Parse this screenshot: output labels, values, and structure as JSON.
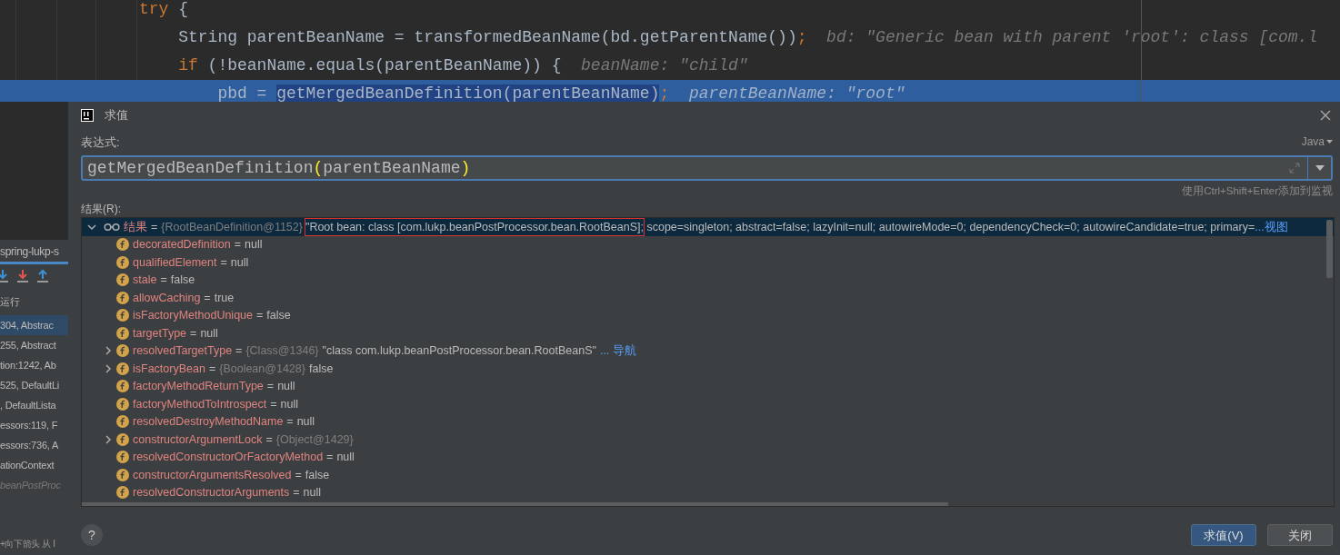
{
  "editor": {
    "lines": [
      {
        "highlighted": false,
        "tokens": [
          {
            "text": "try",
            "kind": "keyword"
          },
          {
            "text": " {",
            "kind": "plain"
          }
        ],
        "children": [
          {
            "highlighted": false,
            "tokens": [
              {
                "text": "String parentBeanName = transformedBeanName(bd.getParentName())",
                "kind": "plain"
              },
              {
                "text": ";",
                "kind": "semicolon"
              }
            ],
            "hint": "bd: \"Generic bean with parent 'root': class [com.l"
          },
          {
            "highlighted": false,
            "tokens": [
              {
                "text": "if",
                "kind": "keyword"
              },
              {
                "text": " (!beanName.equals(parentBeanName)) {",
                "kind": "plain"
              }
            ],
            "hint": "beanName: \"child\"",
            "children": [
              {
                "highlighted": true,
                "tokens": [
                  {
                    "text": "pbd = ",
                    "kind": "plain"
                  },
                  {
                    "text": "getMergedBeanDefinition(parentBeanName)",
                    "kind": "selection"
                  },
                  {
                    "text": ";",
                    "kind": "semicolon"
                  }
                ],
                "hint": "parentBeanName: \"root\""
              }
            ]
          }
        ]
      }
    ]
  },
  "debug_panel": {
    "tab": "spring-lukp-s",
    "label": "运行",
    "frames": [
      {
        "text": "304, Abstrac",
        "selected": true,
        "dimmed": false
      },
      {
        "text": "255, Abstract",
        "selected": false,
        "dimmed": false
      },
      {
        "text": "tion:1242, Ab",
        "selected": false,
        "dimmed": false
      },
      {
        "text": "525, DefaultLi",
        "selected": false,
        "dimmed": false
      },
      {
        "text": ", DefaultLista",
        "selected": false,
        "dimmed": false
      },
      {
        "text": "essors:119, F",
        "selected": false,
        "dimmed": false
      },
      {
        "text": "essors:736, A",
        "selected": false,
        "dimmed": false
      },
      {
        "text": "ationContext",
        "selected": false,
        "dimmed": false
      },
      {
        "text": "beanPostProc",
        "selected": false,
        "dimmed": true
      }
    ],
    "hint": "+向下箭头 从 I"
  },
  "dialog": {
    "title": "求值",
    "expression_label": "表达式:",
    "language": "Java",
    "expression": [
      {
        "text": "getMergedBeanDefinition",
        "kind": "plain"
      },
      {
        "text": "(",
        "kind": "brace-match"
      },
      {
        "text": "parentBeanName",
        "kind": "plain"
      },
      {
        "text": ")",
        "kind": "brace-match"
      }
    ],
    "watch_hint": "使用Ctrl+Shift+Enter添加到监视",
    "result_label": "结果(R):",
    "result": {
      "name": "结果",
      "equals": "=",
      "expanded": true,
      "selected": true,
      "type": "{RootBeanDefinition@1152}",
      "value_parts": [
        {
          "text": "\"Root bean: class [com.lukp.beanPostProcessor.bean.RootBeanS];",
          "boxed": true
        },
        {
          "text": " scope=singleton; abstract=false; lazyInit=null; autowireMode=0; dependencyCheck=0; autowireCandidate=true; primary=",
          "boxed": false
        }
      ],
      "link": "...视图",
      "children": [
        {
          "name": "decoratedDefinition",
          "value": "null",
          "expandable": false
        },
        {
          "name": "qualifiedElement",
          "value": "null",
          "expandable": false
        },
        {
          "name": "stale",
          "value": "false",
          "expandable": false
        },
        {
          "name": "allowCaching",
          "value": "true",
          "expandable": false
        },
        {
          "name": "isFactoryMethodUnique",
          "value": "false",
          "expandable": false
        },
        {
          "name": "targetType",
          "value": "null",
          "expandable": false
        },
        {
          "name": "resolvedTargetType",
          "type": "{Class@1346}",
          "value": "\"class com.lukp.beanPostProcessor.bean.RootBeanS\"",
          "link": "... 导航",
          "expandable": true
        },
        {
          "name": "isFactoryBean",
          "type": "{Boolean@1428}",
          "value": "false",
          "expandable": true
        },
        {
          "name": "factoryMethodReturnType",
          "value": "null",
          "expandable": false
        },
        {
          "name": "factoryMethodToIntrospect",
          "value": "null",
          "expandable": false
        },
        {
          "name": "resolvedDestroyMethodName",
          "value": "null",
          "expandable": false
        },
        {
          "name": "constructorArgumentLock",
          "type": "{Object@1429}",
          "expandable": true
        },
        {
          "name": "resolvedConstructorOrFactoryMethod",
          "value": "null",
          "expandable": false
        },
        {
          "name": "constructorArgumentsResolved",
          "value": "false",
          "expandable": false
        },
        {
          "name": "resolvedConstructorArguments",
          "value": "null",
          "expandable": false
        }
      ]
    },
    "help": "?",
    "buttons": [
      {
        "label": "求值(V)",
        "primary": true
      },
      {
        "label": "关闭",
        "primary": false
      }
    ]
  }
}
